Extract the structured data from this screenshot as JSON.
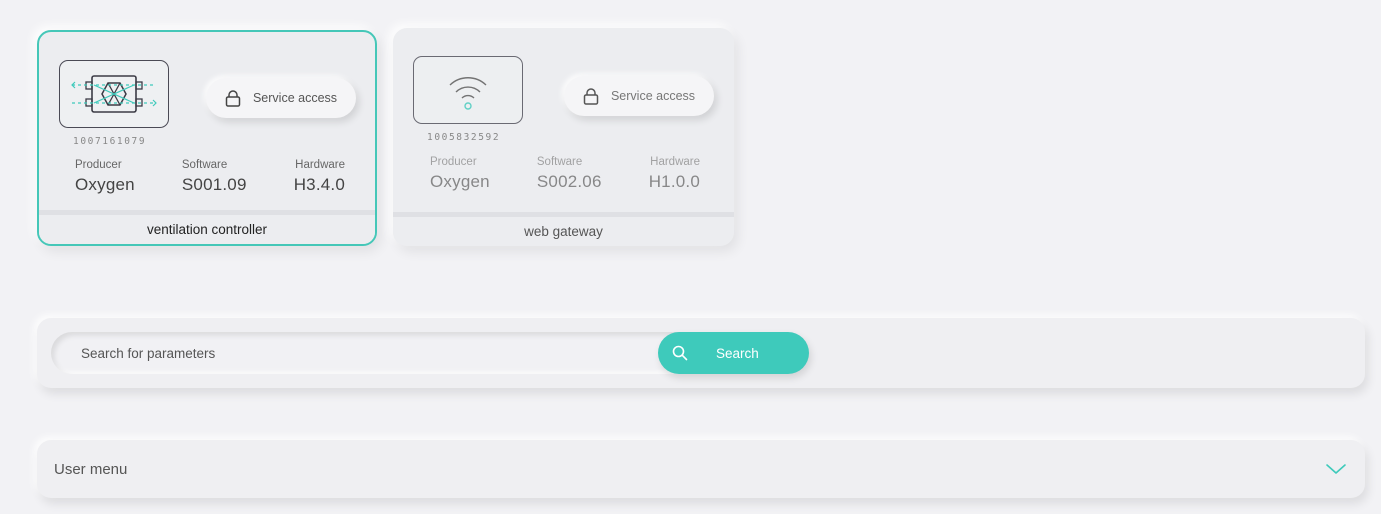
{
  "devices": [
    {
      "serial": "1007161079",
      "service_label": "Service access",
      "producer_label": "Producer",
      "producer": "Oxygen",
      "software_label": "Software",
      "software": "S001.09",
      "hardware_label": "Hardware",
      "hardware": "H3.4.0",
      "name": "ventilation controller",
      "icon": "heat-exchanger-icon",
      "selected": true
    },
    {
      "serial": "1005832592",
      "service_label": "Service access",
      "producer_label": "Producer",
      "producer": "Oxygen",
      "software_label": "Software",
      "software": "S002.06",
      "hardware_label": "Hardware",
      "hardware": "H1.0.0",
      "name": "web gateway",
      "icon": "wifi-icon",
      "selected": false
    }
  ],
  "search": {
    "placeholder": "Search for parameters",
    "value": "",
    "button_label": "Search"
  },
  "user_menu": {
    "label": "User menu",
    "expanded": false
  },
  "colors": {
    "accent": "#3ecabb",
    "selected_border": "#45c7b8",
    "background": "#f2f2f5"
  }
}
